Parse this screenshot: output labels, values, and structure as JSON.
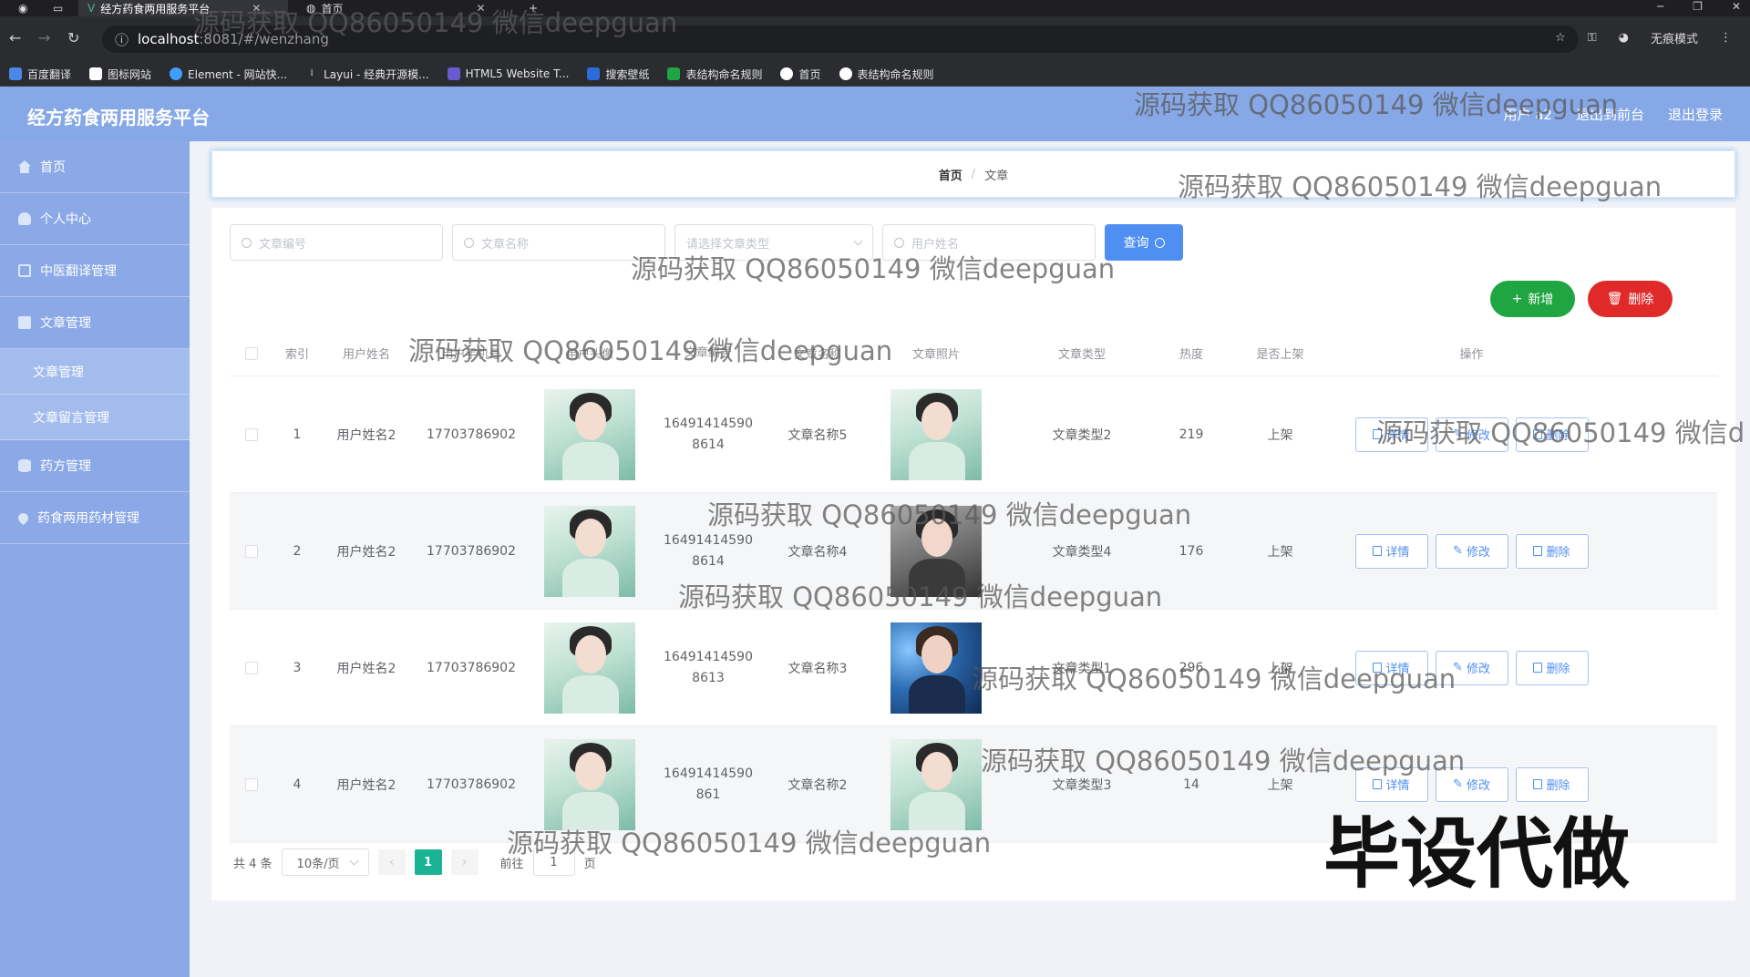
{
  "browser": {
    "tabs": [
      {
        "label": "经方药食两用服务平台",
        "active": true
      },
      {
        "label": "首页",
        "active": false
      }
    ],
    "url_host": "localhost",
    "url_path": ":8081/#/wenzhang",
    "incognito_label": "无痕模式",
    "bookmarks": [
      "百度翻译",
      "图标网站",
      "Element - 网站快...",
      "Layui - 经典开源模...",
      "HTML5 Website T...",
      "搜索壁纸",
      "表结构命名规则",
      "首页",
      "表结构命名规则"
    ]
  },
  "header": {
    "title": "经方药食两用服务平台",
    "user_label": "用户 a2",
    "frontend_label": "退出到前台",
    "logout_label": "退出登录"
  },
  "sidebar": {
    "items": [
      {
        "label": "首页",
        "icon": "home-icon"
      },
      {
        "label": "个人中心",
        "icon": "user-icon"
      },
      {
        "label": "中医翻译管理",
        "icon": "mail-icon"
      },
      {
        "label": "文章管理",
        "icon": "document-icon"
      },
      {
        "label": "文章管理",
        "sub": true
      },
      {
        "label": "文章留言管理",
        "sub": true
      },
      {
        "label": "药方管理",
        "icon": "database-icon"
      },
      {
        "label": "药食两用药材管理",
        "icon": "pin-icon"
      }
    ]
  },
  "breadcrumb": {
    "home": "首页",
    "sep": "/",
    "current": "文章"
  },
  "search": {
    "no_placeholder": "文章编号",
    "title_placeholder": "文章名称",
    "type_placeholder": "请选择文章类型",
    "user_placeholder": "用户姓名",
    "query_label": "查询"
  },
  "actions": {
    "add_label": "新增",
    "delete_label": "删除"
  },
  "table": {
    "headers": [
      "索引",
      "用户姓名",
      "用户手机号",
      "用户头像",
      "文章编号",
      "文章名称",
      "文章照片",
      "文章类型",
      "热度",
      "是否上架",
      "操作"
    ],
    "op_labels": {
      "detail": "详情",
      "edit": "修改",
      "delete": "删除"
    },
    "rows": [
      {
        "idx": "1",
        "name": "用户姓名2",
        "phone": "17703786902",
        "no_1": "16491414590",
        "no_2": "8614",
        "title": "文章名称5",
        "pic": "girl1",
        "type": "文章类型2",
        "heat": "219",
        "shelf": "上架"
      },
      {
        "idx": "2",
        "name": "用户姓名2",
        "phone": "17703786902",
        "no_1": "16491414590",
        "no_2": "8614",
        "title": "文章名称4",
        "pic": "girl2",
        "type": "文章类型4",
        "heat": "176",
        "shelf": "上架"
      },
      {
        "idx": "3",
        "name": "用户姓名2",
        "phone": "17703786902",
        "no_1": "16491414590",
        "no_2": "8613",
        "title": "文章名称3",
        "pic": "boy",
        "type": "文章类型1",
        "heat": "296",
        "shelf": "上架"
      },
      {
        "idx": "4",
        "name": "用户姓名2",
        "phone": "17703786902",
        "no_1": "16491414590",
        "no_2": "861",
        "title": "文章名称2",
        "pic": "girl1",
        "type": "文章类型3",
        "heat": "14",
        "shelf": "上架"
      }
    ]
  },
  "pager": {
    "total": "共 4 条",
    "size": "10条/页",
    "current": "1",
    "goto": "前往",
    "goto_value": "1",
    "page_unit": "页"
  },
  "watermarks": {
    "text": "源码获取 QQ86050149 微信deepguan",
    "clipped": "源码获取 QQ86050149 微信d",
    "big": "毕设代做"
  }
}
